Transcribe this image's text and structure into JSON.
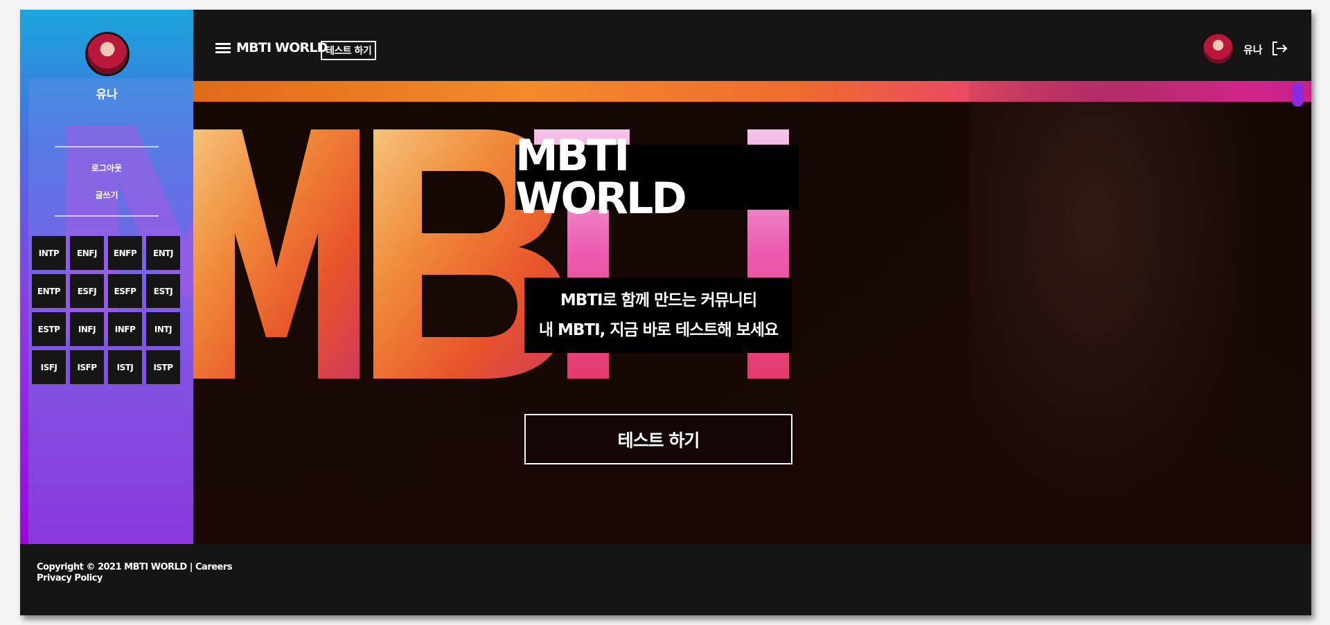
{
  "header": {
    "brand": "MBTI WORLD",
    "test_link": "테스트 하기",
    "user_name": "유나"
  },
  "sidebar": {
    "user_name": "유나",
    "links": [
      "로그아웃",
      "글쓰기"
    ],
    "mbti_types": [
      "INTP",
      "ENFJ",
      "ENFP",
      "ENTJ",
      "ENTP",
      "ESFJ",
      "ESFP",
      "ESTJ",
      "ESTP",
      "INFJ",
      "INFP",
      "INTJ",
      "ISFJ",
      "ISFP",
      "ISTJ",
      "ISTP"
    ]
  },
  "hero": {
    "title": "MBTI WORLD",
    "subtitle_line1": "MBTI로 함께 만드는 커뮤니티",
    "subtitle_line2": "내 MBTI, 지금 바로 테스트해 보세요",
    "cta": "테스트 하기",
    "background_letters": "MBTI"
  },
  "footer": {
    "copyright": "Copyright © 2021 MBTI WORLD | ",
    "careers": "Careers",
    "privacy": "Privacy Policy"
  },
  "colors": {
    "frame": "#151515",
    "sidebar_top": "#1aa6dc",
    "sidebar_bottom": "#9a08d8",
    "scroll_thumb": "#8a2be2"
  }
}
